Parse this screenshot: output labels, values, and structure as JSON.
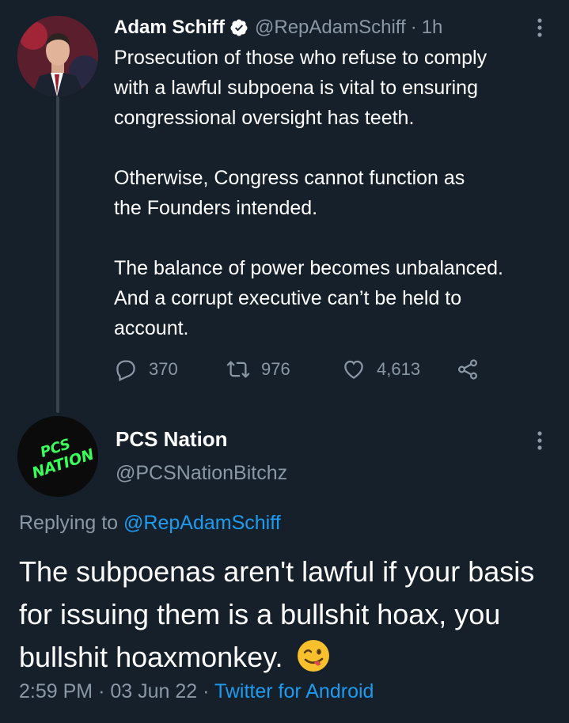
{
  "original_tweet": {
    "author_name": "Adam Schiff",
    "handle": "@RepAdamSchiff",
    "separator": "·",
    "time": "1h",
    "verified": true,
    "paragraphs": [
      "Prosecution of those who refuse to comply\nwith a lawful subpoena is vital to ensuring\ncongressional oversight has teeth.",
      "Otherwise, Congress cannot function as\nthe Founders intended.",
      "The balance of power becomes unbalanced.\nAnd a corrupt executive can’t be held to\naccount."
    ],
    "replies_count": "370",
    "retweets_count": "976",
    "likes_count": "4,613",
    "icons": [
      "reply-icon",
      "retweet-icon",
      "like-icon",
      "share-icon",
      "more-icon",
      "verified-badge-icon"
    ]
  },
  "reply_tweet": {
    "author_name": "PCS Nation",
    "handle": "@PCSNationBitchz",
    "avatar_text": [
      "PCS",
      "NATION"
    ],
    "replying_prefix": "Replying to",
    "replying_handle": "@RepAdamSchiff",
    "text": "The subpoenas aren't lawful if your basis for issuing them is a bullshit hoax, you bullshit hoaxmonkey.",
    "emoji": "winking-face-with-tongue",
    "time": "2:59 PM",
    "date": "03 Jun 22",
    "separator": "·",
    "source": "Twitter for Android"
  },
  "colors": {
    "background": "#15202b",
    "text": "#ffffff",
    "secondary": "#8b98a5",
    "link": "#1d9bf0",
    "avatar_text_green": "#39ff5a"
  }
}
